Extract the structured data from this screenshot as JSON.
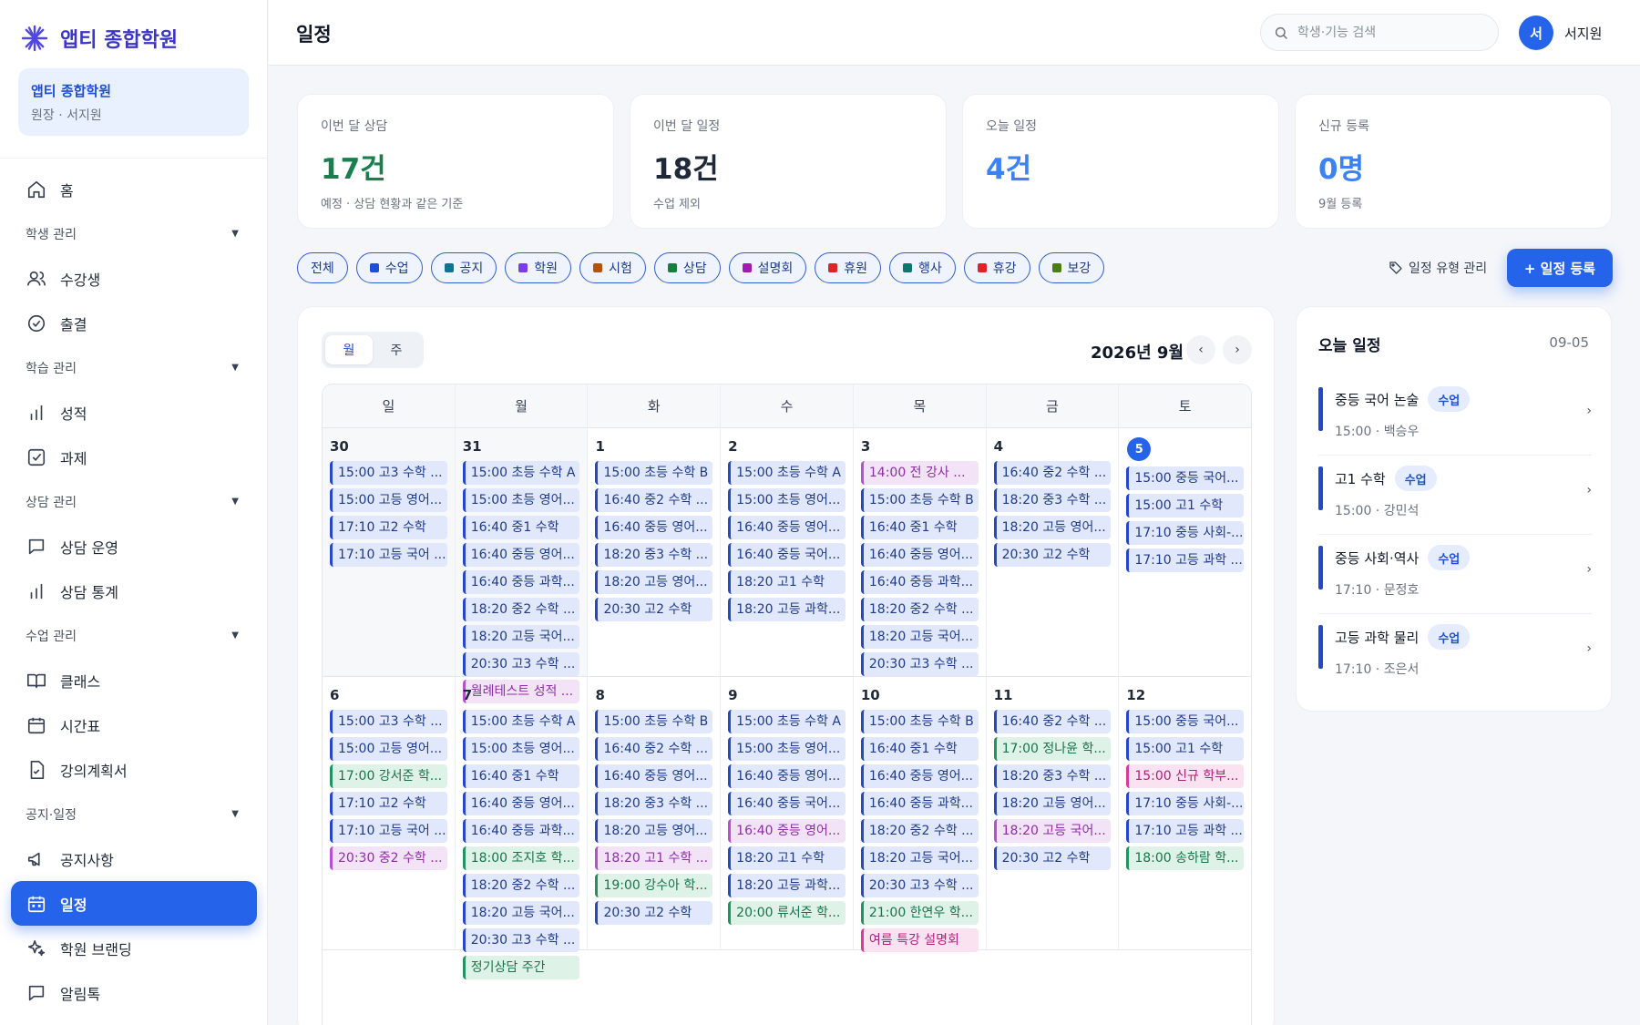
{
  "brand": {
    "icon": "asterisk-logo",
    "name": "앱티 종합학원"
  },
  "org": {
    "name": "앱티 종합학원",
    "role": "원장 · 서지원"
  },
  "nav": {
    "home": "홈",
    "sec_student": "학생 관리",
    "students": "수강생",
    "attendance": "출결",
    "sec_learning": "학습 관리",
    "grades": "성적",
    "homework": "과제",
    "sec_consult": "상담 관리",
    "consult_ops": "상담 운영",
    "consult_stats": "상담 통계",
    "sec_class": "수업 관리",
    "classes": "클래스",
    "timetable": "시간표",
    "syllabus": "강의계획서",
    "sec_notice": "공지·일정",
    "notices": "공지사항",
    "schedule": "일정",
    "branding": "학원 브랜딩",
    "alimtalk": "알림톡"
  },
  "header": {
    "title": "일정",
    "search_placeholder": "학생·기능 검색",
    "avatar": "서",
    "user": "서지원"
  },
  "stats": [
    {
      "label": "이번 달 상담",
      "value": "17건",
      "sub": "예정 · 상담 현황과 같은 기준",
      "color": "#1a7f4e"
    },
    {
      "label": "이번 달 일정",
      "value": "18건",
      "sub": "수업 제외",
      "color": "#1f2937"
    },
    {
      "label": "오늘 일정",
      "value": "4건",
      "sub": "",
      "color": "#3b82f6"
    },
    {
      "label": "신규 등록",
      "value": "0명",
      "sub": "9월 등록",
      "color": "#3b82f6"
    }
  ],
  "filters": [
    {
      "label": "전체",
      "color": ""
    },
    {
      "label": "수업",
      "color": "#1d4ed8"
    },
    {
      "label": "공지",
      "color": "#0e7490"
    },
    {
      "label": "학원",
      "color": "#7c3aed"
    },
    {
      "label": "시험",
      "color": "#b45309"
    },
    {
      "label": "상담",
      "color": "#15803d"
    },
    {
      "label": "설명회",
      "color": "#a21caf"
    },
    {
      "label": "휴원",
      "color": "#dc2626"
    },
    {
      "label": "행사",
      "color": "#0f766e"
    },
    {
      "label": "휴강",
      "color": "#dc2626"
    },
    {
      "label": "보강",
      "color": "#4d7c0f"
    }
  ],
  "actions": {
    "type_mgmt": "일정 유형 관리",
    "add": "+ 일정 등록"
  },
  "calendar": {
    "view_month": "월",
    "view_week": "주",
    "month_label": "2026년 9월",
    "prev": "‹",
    "next": "›",
    "weekdays": [
      "일",
      "월",
      "화",
      "수",
      "목",
      "금",
      "토"
    ],
    "weeks": [
      [
        {
          "day": "30",
          "muted": true,
          "events": [
            [
              "15:00 고3 수학 ...",
              "class"
            ],
            [
              "15:00 고등 영어...",
              "class"
            ],
            [
              "17:10 고2 수학",
              "class"
            ],
            [
              "17:10 고등 국어 ...",
              "class"
            ]
          ]
        },
        {
          "day": "31",
          "muted": true,
          "events": [
            [
              "15:00 초등 수학 A",
              "class"
            ],
            [
              "15:00 초등 영어...",
              "class"
            ],
            [
              "16:40 중1 수학",
              "class"
            ],
            [
              "16:40 중등 영어...",
              "class"
            ],
            [
              "16:40 중등 과학...",
              "class"
            ],
            [
              "18:20 중2 수학 ...",
              "class"
            ],
            [
              "18:20 고등 국어...",
              "class"
            ],
            [
              "20:30 고3 수학 ...",
              "class"
            ],
            [
              "월례테스트 성적 ...",
              "lec"
            ]
          ]
        },
        {
          "day": "1",
          "events": [
            [
              "15:00 초등 수학 B",
              "class"
            ],
            [
              "16:40 중2 수학 ...",
              "class"
            ],
            [
              "16:40 중등 영어...",
              "class"
            ],
            [
              "18:20 중3 수학 ...",
              "class"
            ],
            [
              "18:20 고등 영어...",
              "class"
            ],
            [
              "20:30 고2 수학",
              "class"
            ]
          ]
        },
        {
          "day": "2",
          "events": [
            [
              "15:00 초등 수학 A",
              "class"
            ],
            [
              "15:00 초등 영어...",
              "class"
            ],
            [
              "16:40 중등 영어...",
              "class"
            ],
            [
              "16:40 중등 국어...",
              "class"
            ],
            [
              "18:20 고1 수학",
              "class"
            ],
            [
              "18:20 고등 과학...",
              "class"
            ]
          ]
        },
        {
          "day": "3",
          "events": [
            [
              "14:00 전 강사 ...",
              "lec"
            ],
            [
              "15:00 초등 수학 B",
              "class"
            ],
            [
              "16:40 중1 수학",
              "class"
            ],
            [
              "16:40 중등 영어...",
              "class"
            ],
            [
              "16:40 중등 과학...",
              "class"
            ],
            [
              "18:20 중2 수학 ...",
              "class"
            ],
            [
              "18:20 고등 국어...",
              "class"
            ],
            [
              "20:30 고3 수학 ...",
              "class"
            ]
          ]
        },
        {
          "day": "4",
          "events": [
            [
              "16:40 중2 수학 ...",
              "class"
            ],
            [
              "18:20 중3 수학 ...",
              "class"
            ],
            [
              "18:20 고등 영어...",
              "class"
            ],
            [
              "20:30 고2 수학",
              "class"
            ]
          ]
        },
        {
          "day": "5",
          "today": true,
          "events": [
            [
              "15:00 중등 국어...",
              "class"
            ],
            [
              "15:00 고1 수학",
              "class"
            ],
            [
              "17:10 중등 사회-...",
              "class"
            ],
            [
              "17:10 고등 과학 ...",
              "class"
            ]
          ]
        }
      ],
      [
        {
          "day": "6",
          "events": [
            [
              "15:00 고3 수학 ...",
              "class"
            ],
            [
              "15:00 고등 영어...",
              "class"
            ],
            [
              "17:00 강서준 학...",
              "cons"
            ],
            [
              "17:10 고2 수학",
              "class"
            ],
            [
              "17:10 고등 국어 ...",
              "class"
            ],
            [
              "20:30 중2 수학 ...",
              "lec"
            ]
          ]
        },
        {
          "day": "7",
          "events": [
            [
              "15:00 초등 수학 A",
              "class"
            ],
            [
              "15:00 초등 영어...",
              "class"
            ],
            [
              "16:40 중1 수학",
              "class"
            ],
            [
              "16:40 중등 영어...",
              "class"
            ],
            [
              "16:40 중등 과학...",
              "class"
            ],
            [
              "18:00 조지호 학...",
              "cons"
            ],
            [
              "18:20 중2 수학 ...",
              "class"
            ],
            [
              "18:20 고등 국어...",
              "class"
            ],
            [
              "20:30 고3 수학 ...",
              "class"
            ],
            [
              "정기상담 주간",
              "cons"
            ]
          ]
        },
        {
          "day": "8",
          "events": [
            [
              "15:00 초등 수학 B",
              "class"
            ],
            [
              "16:40 중2 수학 ...",
              "class"
            ],
            [
              "16:40 중등 영어...",
              "class"
            ],
            [
              "18:20 중3 수학 ...",
              "class"
            ],
            [
              "18:20 고등 영어...",
              "class"
            ],
            [
              "18:20 고1 수학 ...",
              "lec"
            ],
            [
              "19:00 강수아 학...",
              "cons"
            ],
            [
              "20:30 고2 수학",
              "class"
            ]
          ]
        },
        {
          "day": "9",
          "events": [
            [
              "15:00 초등 수학 A",
              "class"
            ],
            [
              "15:00 초등 영어...",
              "class"
            ],
            [
              "16:40 중등 영어...",
              "class"
            ],
            [
              "16:40 중등 국어...",
              "class"
            ],
            [
              "16:40 중등 영어...",
              "lec"
            ],
            [
              "18:20 고1 수학",
              "class"
            ],
            [
              "18:20 고등 과학...",
              "class"
            ],
            [
              "20:00 류서준 학...",
              "cons"
            ]
          ]
        },
        {
          "day": "10",
          "events": [
            [
              "15:00 초등 수학 B",
              "class"
            ],
            [
              "16:40 중1 수학",
              "class"
            ],
            [
              "16:40 중등 영어...",
              "class"
            ],
            [
              "16:40 중등 과학...",
              "class"
            ],
            [
              "18:20 중2 수학 ...",
              "class"
            ],
            [
              "18:20 고등 국어...",
              "class"
            ],
            [
              "20:30 고3 수학 ...",
              "class"
            ],
            [
              "21:00 한연우 학...",
              "cons"
            ],
            [
              "여름 특강 설명회",
              "pink"
            ]
          ]
        },
        {
          "day": "11",
          "events": [
            [
              "16:40 중2 수학 ...",
              "class"
            ],
            [
              "17:00 정나윤 학...",
              "cons"
            ],
            [
              "18:20 중3 수학 ...",
              "class"
            ],
            [
              "18:20 고등 영어...",
              "class"
            ],
            [
              "18:20 고등 국어...",
              "lec"
            ],
            [
              "20:30 고2 수학",
              "class"
            ]
          ]
        },
        {
          "day": "12",
          "events": [
            [
              "15:00 중등 국어...",
              "class"
            ],
            [
              "15:00 고1 수학",
              "class"
            ],
            [
              "15:00 신규 학부...",
              "pink"
            ],
            [
              "17:10 중등 사회-...",
              "class"
            ],
            [
              "17:10 고등 과학 ...",
              "class"
            ],
            [
              "18:00 송하람 학...",
              "cons"
            ]
          ]
        }
      ]
    ]
  },
  "today_panel": {
    "title": "오늘 일정",
    "date": "09-05",
    "items": [
      {
        "name": "중등 국어 논술",
        "badge": "수업",
        "meta": "15:00 · 백승우"
      },
      {
        "name": "고1 수학",
        "badge": "수업",
        "meta": "15:00 · 강민석"
      },
      {
        "name": "중등 사회·역사",
        "badge": "수업",
        "meta": "17:10 · 문정호"
      },
      {
        "name": "고등 과학 물리",
        "badge": "수업",
        "meta": "17:10 · 조은서"
      }
    ]
  }
}
